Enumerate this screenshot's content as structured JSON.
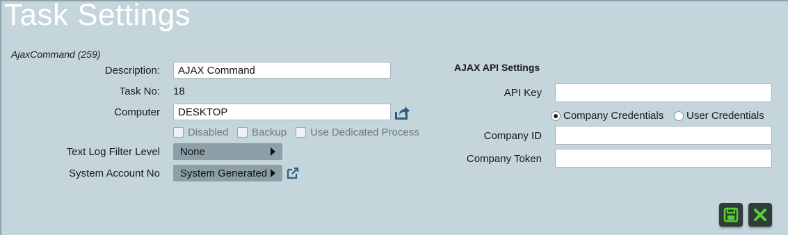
{
  "page": {
    "title": "Task Settings",
    "subtitle": "AjaxCommand (259)"
  },
  "form": {
    "description_label": "Description:",
    "description_value": "AJAX Command",
    "taskno_label": "Task No:",
    "taskno_value": "18",
    "computer_label": "Computer",
    "computer_value": "DESKTOP",
    "disabled_label": "Disabled",
    "backup_label": "Backup",
    "dedicated_label": "Use Dedicated Process",
    "loglevel_label": "Text Log Filter Level",
    "loglevel_value": "None",
    "account_label": "System Account No",
    "account_value": "System Generated"
  },
  "api": {
    "section_title": "AJAX API Settings",
    "apikey_label": "API Key",
    "apikey_value": "",
    "radio_company": "Company Credentials",
    "radio_user": "User Credentials",
    "selected_credentials": "Company Credentials",
    "companyid_label": "Company ID",
    "companyid_value": "",
    "companytoken_label": "Company Token",
    "companytoken_value": ""
  },
  "icons": {
    "computer_action": "share-export-icon",
    "account_link": "external-link-icon",
    "save": "save-icon",
    "cancel": "close-icon"
  },
  "colors": {
    "background": "#c5d5dc",
    "select_bg": "#8da0a8",
    "button_bg": "#2e3d3a",
    "button_icon": "#5bd12e",
    "icon_blue": "#2e5f82"
  }
}
